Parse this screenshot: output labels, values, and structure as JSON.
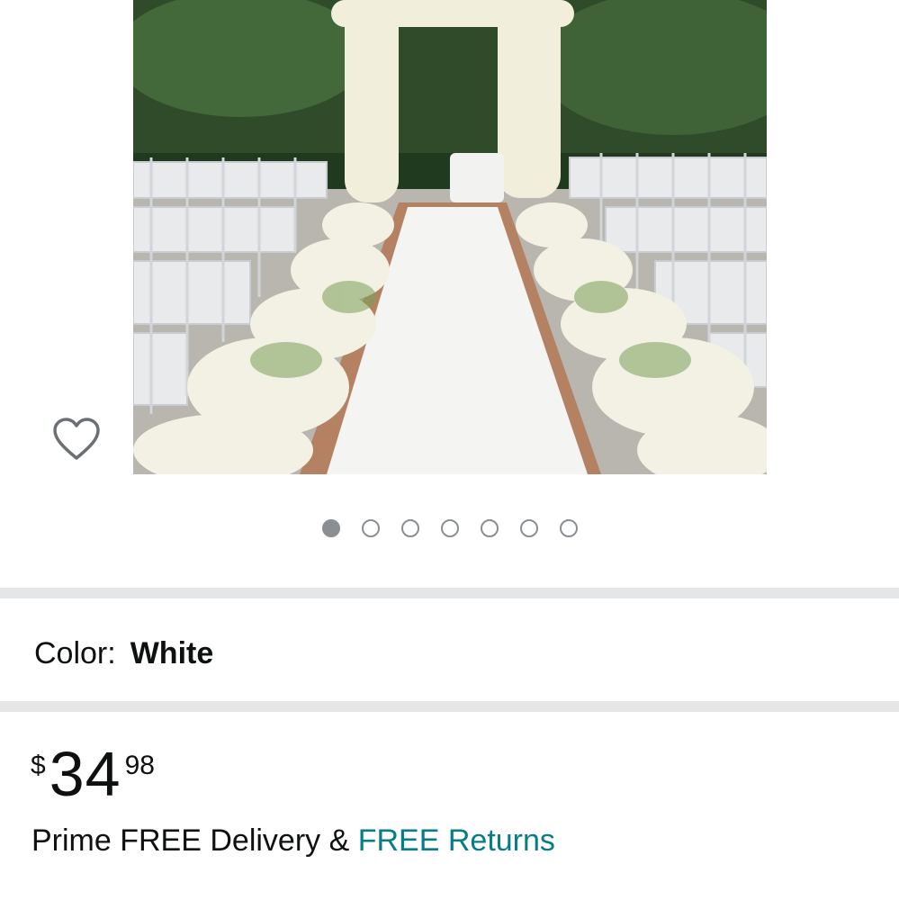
{
  "gallery": {
    "image_alt": "White aisle runner between rows of white chairs with floral arch",
    "dots": [
      true,
      false,
      false,
      false,
      false,
      false,
      false
    ]
  },
  "wishlist": {
    "icon": "heart-outline-icon"
  },
  "color": {
    "label": "Color:",
    "value": "White"
  },
  "price": {
    "symbol": "$",
    "whole": "34",
    "fraction": "98"
  },
  "delivery": {
    "prefix": "Prime FREE Delivery & ",
    "link": "FREE Returns"
  },
  "colors": {
    "link": "#067d87",
    "divider": "#e4e6e8",
    "dot": "#8a8f94"
  }
}
